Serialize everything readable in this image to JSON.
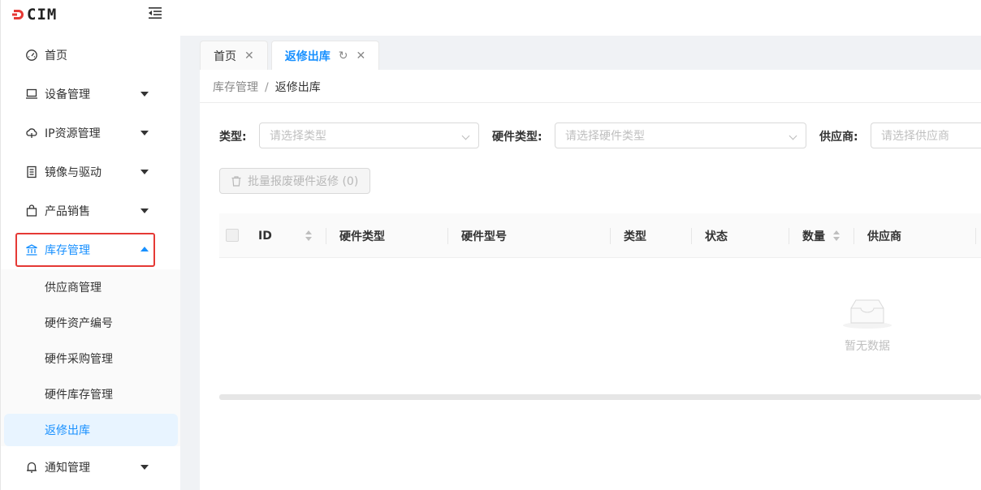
{
  "logo": {
    "text": "CIM"
  },
  "sidebar": {
    "items": [
      {
        "label": "首页",
        "icon": "dashboard-icon"
      },
      {
        "label": "设备管理",
        "icon": "monitor-icon"
      },
      {
        "label": "IP资源管理",
        "icon": "cloud-icon"
      },
      {
        "label": "镜像与驱动",
        "icon": "disk-icon"
      },
      {
        "label": "产品销售",
        "icon": "bag-icon"
      },
      {
        "label": "库存管理",
        "icon": "bank-icon"
      },
      {
        "label": "通知管理",
        "icon": "bell-icon"
      }
    ],
    "submenu": [
      "供应商管理",
      "硬件资产编号",
      "硬件采购管理",
      "硬件库存管理",
      "返修出库"
    ]
  },
  "tabs": [
    {
      "label": "首页"
    },
    {
      "label": "返修出库"
    }
  ],
  "breadcrumb": {
    "parent": "库存管理",
    "sep": "/",
    "current": "返修出库"
  },
  "filters": {
    "type_label": "类型:",
    "type_placeholder": "请选择类型",
    "hw_type_label": "硬件类型:",
    "hw_type_placeholder": "请选择硬件类型",
    "supplier_label": "供应商:",
    "supplier_placeholder": "请选择供应商"
  },
  "batch_button": "批量报废硬件返修 (0)",
  "table": {
    "columns": [
      "ID",
      "硬件类型",
      "硬件型号",
      "类型",
      "状态",
      "数量",
      "供应商"
    ],
    "empty_text": "暂无数据"
  },
  "colors": {
    "accent": "#1890ff",
    "highlight": "#e53935",
    "logo_mark": "#e53935"
  }
}
